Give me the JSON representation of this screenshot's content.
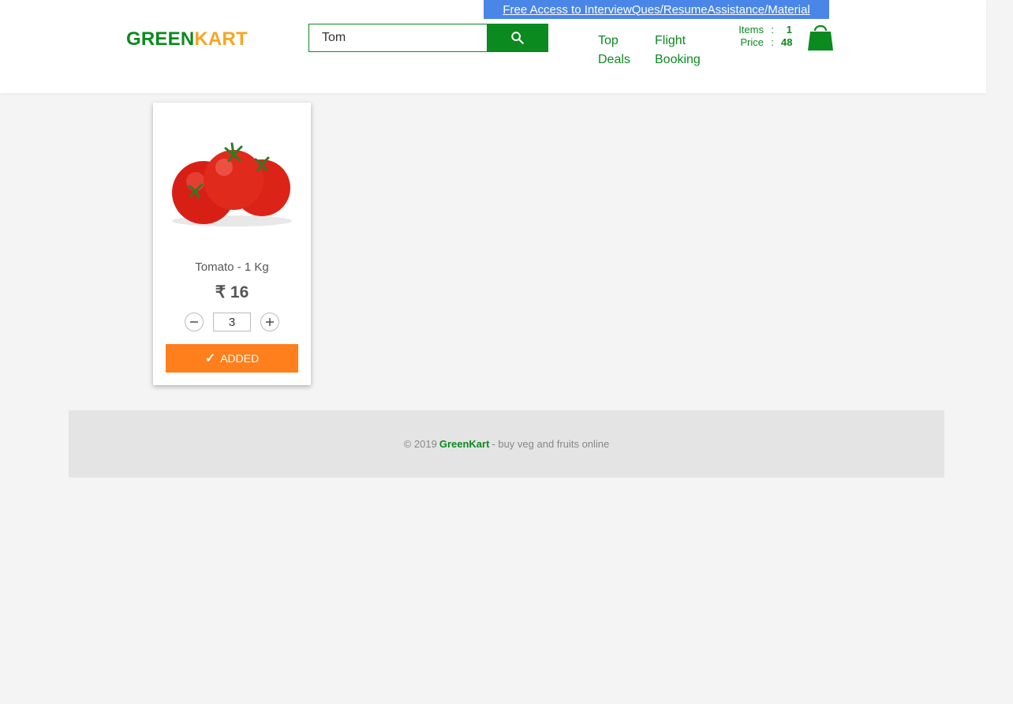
{
  "header": {
    "promo_link": "Free Access to InterviewQues/ResumeAssistance/Material",
    "logo_green": "GREEN",
    "logo_kart": "KART",
    "search": {
      "value": "Tom",
      "button_icon": "search-icon"
    },
    "nav": {
      "top_deals": "Top Deals",
      "flight_booking": "Flight Booking"
    },
    "cart": {
      "items_label": "Items",
      "items_value": "1",
      "price_label": "Price",
      "price_value": "48",
      "separator": ":",
      "icon": "shopping-bag-icon"
    }
  },
  "products": [
    {
      "name": "Tomato - 1 Kg",
      "price": "₹ 16",
      "quantity": "3",
      "button_label": "ADDED",
      "button_icon": "checkmark-icon",
      "image": "tomatoes-image"
    }
  ],
  "footer": {
    "copyright": "© 2019",
    "brand": "GreenKart",
    "tagline": "- buy veg and fruits online"
  },
  "colors": {
    "brand_green": "#0b8a1f",
    "brand_orange": "#f5a623",
    "button_orange": "#ff7f1c",
    "promo_blue": "#4a86e8",
    "background": "#f4f4f4",
    "footer_bg": "#e4e4e4"
  }
}
